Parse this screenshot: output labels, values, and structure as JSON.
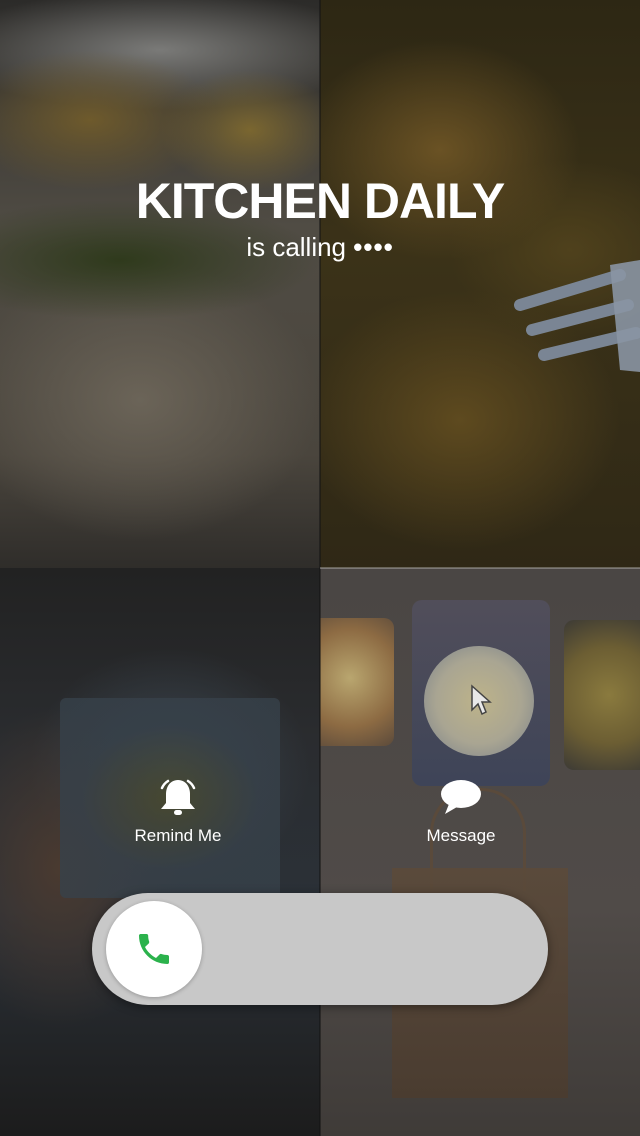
{
  "caller": {
    "name": "KITCHEN DAILY",
    "status": "is calling",
    "dots": "••••"
  },
  "actions": {
    "remind": {
      "label": "Remind Me",
      "icon": "bell-icon"
    },
    "message": {
      "label": "Message",
      "icon": "speech-bubble-icon"
    }
  },
  "answer_slider": {
    "icon": "phone-icon",
    "accent_color": "#2bb24c"
  },
  "colors": {
    "text": "#ffffff",
    "slider_track": "#c8c8c8",
    "knob": "#ffffff"
  }
}
